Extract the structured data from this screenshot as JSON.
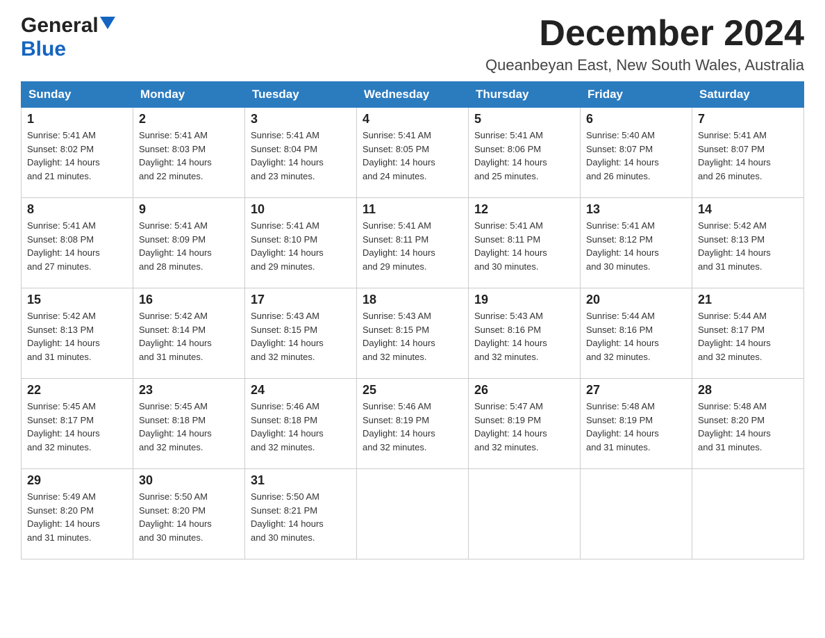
{
  "header": {
    "logo_general": "General",
    "logo_blue": "Blue",
    "title": "December 2024",
    "subtitle": "Queanbeyan East, New South Wales, Australia"
  },
  "days_of_week": [
    "Sunday",
    "Monday",
    "Tuesday",
    "Wednesday",
    "Thursday",
    "Friday",
    "Saturday"
  ],
  "weeks": [
    [
      {
        "day": "1",
        "sunrise": "5:41 AM",
        "sunset": "8:02 PM",
        "daylight": "14 hours and 21 minutes."
      },
      {
        "day": "2",
        "sunrise": "5:41 AM",
        "sunset": "8:03 PM",
        "daylight": "14 hours and 22 minutes."
      },
      {
        "day": "3",
        "sunrise": "5:41 AM",
        "sunset": "8:04 PM",
        "daylight": "14 hours and 23 minutes."
      },
      {
        "day": "4",
        "sunrise": "5:41 AM",
        "sunset": "8:05 PM",
        "daylight": "14 hours and 24 minutes."
      },
      {
        "day": "5",
        "sunrise": "5:41 AM",
        "sunset": "8:06 PM",
        "daylight": "14 hours and 25 minutes."
      },
      {
        "day": "6",
        "sunrise": "5:40 AM",
        "sunset": "8:07 PM",
        "daylight": "14 hours and 26 minutes."
      },
      {
        "day": "7",
        "sunrise": "5:41 AM",
        "sunset": "8:07 PM",
        "daylight": "14 hours and 26 minutes."
      }
    ],
    [
      {
        "day": "8",
        "sunrise": "5:41 AM",
        "sunset": "8:08 PM",
        "daylight": "14 hours and 27 minutes."
      },
      {
        "day": "9",
        "sunrise": "5:41 AM",
        "sunset": "8:09 PM",
        "daylight": "14 hours and 28 minutes."
      },
      {
        "day": "10",
        "sunrise": "5:41 AM",
        "sunset": "8:10 PM",
        "daylight": "14 hours and 29 minutes."
      },
      {
        "day": "11",
        "sunrise": "5:41 AM",
        "sunset": "8:11 PM",
        "daylight": "14 hours and 29 minutes."
      },
      {
        "day": "12",
        "sunrise": "5:41 AM",
        "sunset": "8:11 PM",
        "daylight": "14 hours and 30 minutes."
      },
      {
        "day": "13",
        "sunrise": "5:41 AM",
        "sunset": "8:12 PM",
        "daylight": "14 hours and 30 minutes."
      },
      {
        "day": "14",
        "sunrise": "5:42 AM",
        "sunset": "8:13 PM",
        "daylight": "14 hours and 31 minutes."
      }
    ],
    [
      {
        "day": "15",
        "sunrise": "5:42 AM",
        "sunset": "8:13 PM",
        "daylight": "14 hours and 31 minutes."
      },
      {
        "day": "16",
        "sunrise": "5:42 AM",
        "sunset": "8:14 PM",
        "daylight": "14 hours and 31 minutes."
      },
      {
        "day": "17",
        "sunrise": "5:43 AM",
        "sunset": "8:15 PM",
        "daylight": "14 hours and 32 minutes."
      },
      {
        "day": "18",
        "sunrise": "5:43 AM",
        "sunset": "8:15 PM",
        "daylight": "14 hours and 32 minutes."
      },
      {
        "day": "19",
        "sunrise": "5:43 AM",
        "sunset": "8:16 PM",
        "daylight": "14 hours and 32 minutes."
      },
      {
        "day": "20",
        "sunrise": "5:44 AM",
        "sunset": "8:16 PM",
        "daylight": "14 hours and 32 minutes."
      },
      {
        "day": "21",
        "sunrise": "5:44 AM",
        "sunset": "8:17 PM",
        "daylight": "14 hours and 32 minutes."
      }
    ],
    [
      {
        "day": "22",
        "sunrise": "5:45 AM",
        "sunset": "8:17 PM",
        "daylight": "14 hours and 32 minutes."
      },
      {
        "day": "23",
        "sunrise": "5:45 AM",
        "sunset": "8:18 PM",
        "daylight": "14 hours and 32 minutes."
      },
      {
        "day": "24",
        "sunrise": "5:46 AM",
        "sunset": "8:18 PM",
        "daylight": "14 hours and 32 minutes."
      },
      {
        "day": "25",
        "sunrise": "5:46 AM",
        "sunset": "8:19 PM",
        "daylight": "14 hours and 32 minutes."
      },
      {
        "day": "26",
        "sunrise": "5:47 AM",
        "sunset": "8:19 PM",
        "daylight": "14 hours and 32 minutes."
      },
      {
        "day": "27",
        "sunrise": "5:48 AM",
        "sunset": "8:19 PM",
        "daylight": "14 hours and 31 minutes."
      },
      {
        "day": "28",
        "sunrise": "5:48 AM",
        "sunset": "8:20 PM",
        "daylight": "14 hours and 31 minutes."
      }
    ],
    [
      {
        "day": "29",
        "sunrise": "5:49 AM",
        "sunset": "8:20 PM",
        "daylight": "14 hours and 31 minutes."
      },
      {
        "day": "30",
        "sunrise": "5:50 AM",
        "sunset": "8:20 PM",
        "daylight": "14 hours and 30 minutes."
      },
      {
        "day": "31",
        "sunrise": "5:50 AM",
        "sunset": "8:21 PM",
        "daylight": "14 hours and 30 minutes."
      },
      null,
      null,
      null,
      null
    ]
  ],
  "labels": {
    "sunrise": "Sunrise:",
    "sunset": "Sunset:",
    "daylight": "Daylight:"
  }
}
